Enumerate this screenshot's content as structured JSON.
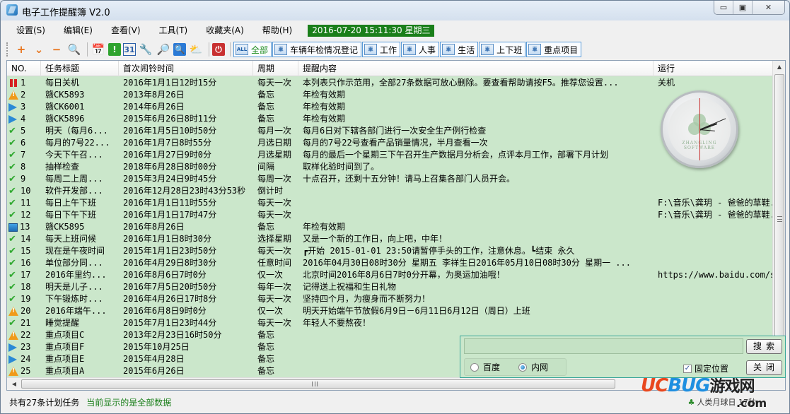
{
  "window": {
    "title": "电子工作提醒簿 V2.0",
    "controls": {
      "minimize": "▭",
      "maximize": "▣",
      "close": "✕"
    }
  },
  "menu": {
    "items": [
      "设置(S)",
      "编辑(E)",
      "查看(V)",
      "工具(T)",
      "收藏夹(A)",
      "帮助(H)"
    ],
    "clock": "2016-07-20 15:11:30  星期三"
  },
  "toolbar": {
    "icons": [
      {
        "name": "add-icon",
        "glyph": "+",
        "color": "#e8731a"
      },
      {
        "name": "chevron-down-icon",
        "glyph": "⌄",
        "color": "#e8731a"
      },
      {
        "name": "remove-icon",
        "glyph": "−",
        "color": "#e8731a"
      },
      {
        "name": "search-icon",
        "glyph": "🔍",
        "color": "#7a8ea8"
      },
      {
        "name": "calendar-icon",
        "glyph": "📅",
        "color": "#5a6c88"
      },
      {
        "name": "alert-icon",
        "glyph": "!",
        "color": "#ffffff"
      },
      {
        "name": "date-31-icon",
        "glyph": "31",
        "color": "#2a5ea8"
      },
      {
        "name": "wrench-icon",
        "glyph": "🔧",
        "color": "#555555"
      },
      {
        "name": "document-search-icon",
        "glyph": "🔎",
        "color": "#2a5ea8"
      },
      {
        "name": "magnifier-blue-icon",
        "glyph": "🔍",
        "color": "#ffffff"
      },
      {
        "name": "weather-icon",
        "glyph": "⛅",
        "color": "#f2b01a"
      },
      {
        "name": "power-icon",
        "glyph": "⏻",
        "color": "#ffffff"
      }
    ],
    "categories": [
      {
        "label": "全部",
        "icon": "ALL",
        "active": true
      },
      {
        "label": "车辆年检情况登记",
        "icon": "車",
        "active": false
      },
      {
        "label": "工作",
        "icon": "車",
        "active": false
      },
      {
        "label": "人事",
        "icon": "車",
        "active": false
      },
      {
        "label": "生活",
        "icon": "車",
        "active": false
      },
      {
        "label": "上下班",
        "icon": "車",
        "active": false
      },
      {
        "label": "重点项目",
        "icon": "車",
        "active": false
      }
    ]
  },
  "table": {
    "columns": [
      "NO.",
      "任务标题",
      "首次闹铃时间",
      "周期",
      "提醒内容",
      "运行"
    ],
    "rows": [
      {
        "status": "pause",
        "no": "1",
        "title": "每日关机",
        "time": "2016年1月1日12时15分",
        "cycle": "每天一次",
        "content": "本列表只作示范用，全部27条数据可放心删除。要查看帮助请按F5。推荐您设置...",
        "run": "关机"
      },
      {
        "status": "warn",
        "no": "2",
        "title": "赣CK5893",
        "time": "2013年8月26日",
        "cycle": "备忘",
        "content": "年检有效期",
        "run": ""
      },
      {
        "status": "play",
        "no": "3",
        "title": "赣CK6001",
        "time": "2014年6月26日",
        "cycle": "备忘",
        "content": "年检有效期",
        "run": ""
      },
      {
        "status": "play",
        "no": "4",
        "title": "赣CK5896",
        "time": "2015年6月26日8时11分",
        "cycle": "备忘",
        "content": "年检有效期",
        "run": ""
      },
      {
        "status": "check",
        "no": "5",
        "title": "明天（每月6...",
        "time": "2016年1月5日10时50分",
        "cycle": "每月一次",
        "content": "每月6日对下辖各部门进行一次安全生产例行检查",
        "run": ""
      },
      {
        "status": "check",
        "no": "6",
        "title": "每月的7号22...",
        "time": "2016年1月7日8时55分",
        "cycle": "月选日期",
        "content": "每月的7号22号查看产品销量情况，半月查看一次",
        "run": ""
      },
      {
        "status": "check",
        "no": "7",
        "title": "今天下午召...",
        "time": "2016年1月27日9时0分",
        "cycle": "月选星期",
        "content": "每月的最后一个星期三下午召开生产数据月分析会，点评本月工作，部署下月计划",
        "run": ""
      },
      {
        "status": "check",
        "no": "8",
        "title": "抽样检查",
        "time": "2018年6月28日8时00分",
        "cycle": "间隔",
        "content": "取样化验时间到了。",
        "run": ""
      },
      {
        "status": "check",
        "no": "9",
        "title": "每周二上周...",
        "time": "2015年3月24日9时45分",
        "cycle": "每周一次",
        "content": "十点召开，还剩十五分钟！请马上召集各部门人员开会。",
        "run": ""
      },
      {
        "status": "check",
        "no": "10",
        "title": "软件开发部...",
        "time": "2016年12月28日23时43分53秒",
        "cycle": "倒计时",
        "content": "",
        "run": ""
      },
      {
        "status": "check",
        "no": "11",
        "title": "每日上午下班",
        "time": "2016年1月1日11时55分",
        "cycle": "每天一次",
        "content": "",
        "run": "F:\\音乐\\龚玥 - 爸爸的草鞋."
      },
      {
        "status": "check",
        "no": "12",
        "title": "每日下午下班",
        "time": "2016年1月1日17时47分",
        "cycle": "每天一次",
        "content": "",
        "run": "F:\\音乐\\龚玥 - 爸爸的草鞋."
      },
      {
        "status": "square",
        "no": "13",
        "title": "赣CK5895",
        "time": "2016年8月26日",
        "cycle": "备忘",
        "content": "年检有效期",
        "run": ""
      },
      {
        "status": "check",
        "no": "14",
        "title": "每天上班问候",
        "time": "2016年1月1日8时30分",
        "cycle": "选择星期",
        "content": "又是一个新的工作日，向上吧，中年！",
        "run": ""
      },
      {
        "status": "check",
        "no": "15",
        "title": "现在是午夜时间",
        "time": "2015年1月1日23时50分",
        "cycle": "每天一次",
        "content": " ┏开始 2015-01-01 23:50请暂停手头的工作，注意休息。┗结束 永久",
        "run": ""
      },
      {
        "status": "check",
        "no": "16",
        "title": "单位部分同...",
        "time": "2016年4月29日8时30分",
        "cycle": "任意时间",
        "content": "2016年04月30日08时30分 星期五 李祥生日2016年05月10日08时30分 星期一 ...",
        "run": ""
      },
      {
        "status": "check",
        "no": "17",
        "title": "2016年里约...",
        "time": "2016年8月6日7时0分",
        "cycle": "仅一次",
        "content": "北京时间2016年8月6日7时0分开幕，为奥运加油哦！",
        "run": "https://www.baidu.com/s?"
      },
      {
        "status": "check",
        "no": "18",
        "title": "明天是儿子...",
        "time": "2016年7月5日20时50分",
        "cycle": "每年一次",
        "content": "记得送上祝福和生日礼物",
        "run": ""
      },
      {
        "status": "check",
        "no": "19",
        "title": "下午锻炼时...",
        "time": "2016年4月26日17时8分",
        "cycle": "每天一次",
        "content": "坚持四个月，为瘦身而不断努力！",
        "run": ""
      },
      {
        "status": "warn",
        "no": "20",
        "title": "2016年端午...",
        "time": "2016年6月8日9时0分",
        "cycle": "仅一次",
        "content": "明天开始端午节放假6月9日－6月11日6月12日（周日）上班",
        "run": ""
      },
      {
        "status": "check",
        "no": "21",
        "title": "睡觉提醒",
        "time": "2015年7月1日23时44分",
        "cycle": "每天一次",
        "content": "年轻人不要熬夜！",
        "run": ""
      },
      {
        "status": "warn",
        "no": "22",
        "title": "重点项目C",
        "time": "2013年2月23日16时50分",
        "cycle": "备忘",
        "content": "",
        "run": ""
      },
      {
        "status": "play",
        "no": "23",
        "title": "重点项目F",
        "time": "2015年10月25日",
        "cycle": "备忘",
        "content": "",
        "run": ""
      },
      {
        "status": "play",
        "no": "24",
        "title": "重点项目E",
        "time": "2015年4月28日",
        "cycle": "备忘",
        "content": "",
        "run": ""
      },
      {
        "status": "warn",
        "no": "25",
        "title": "重点项目A",
        "time": "2015年6月26日",
        "cycle": "备忘",
        "content": "",
        "run": ""
      }
    ]
  },
  "clock_widget": {
    "brand": "ZHANGLING SOFTWARE",
    "time": "15:11:30"
  },
  "search_panel": {
    "query": "",
    "search_label": "搜索",
    "close_label": "关闭",
    "engines": [
      {
        "label": "百度",
        "selected": false
      },
      {
        "label": "内网",
        "selected": true
      }
    ],
    "pin_label": "固定位置",
    "pin_checked": true
  },
  "status": {
    "count": "共有27条计划任务",
    "filter": "当前显示的是全部数据",
    "right_text": "人类月球日  17秒"
  },
  "watermark": {
    "brand_a": "UC",
    "brand_b": "BUG",
    "brand_cn": "游戏网",
    "domain": ".com"
  },
  "colors": {
    "row_bg": "#cbe7cb",
    "clock_badge": "#1a7f1a",
    "accent_blue": "#5a9bd8",
    "status_green": "#1a7f1a"
  }
}
